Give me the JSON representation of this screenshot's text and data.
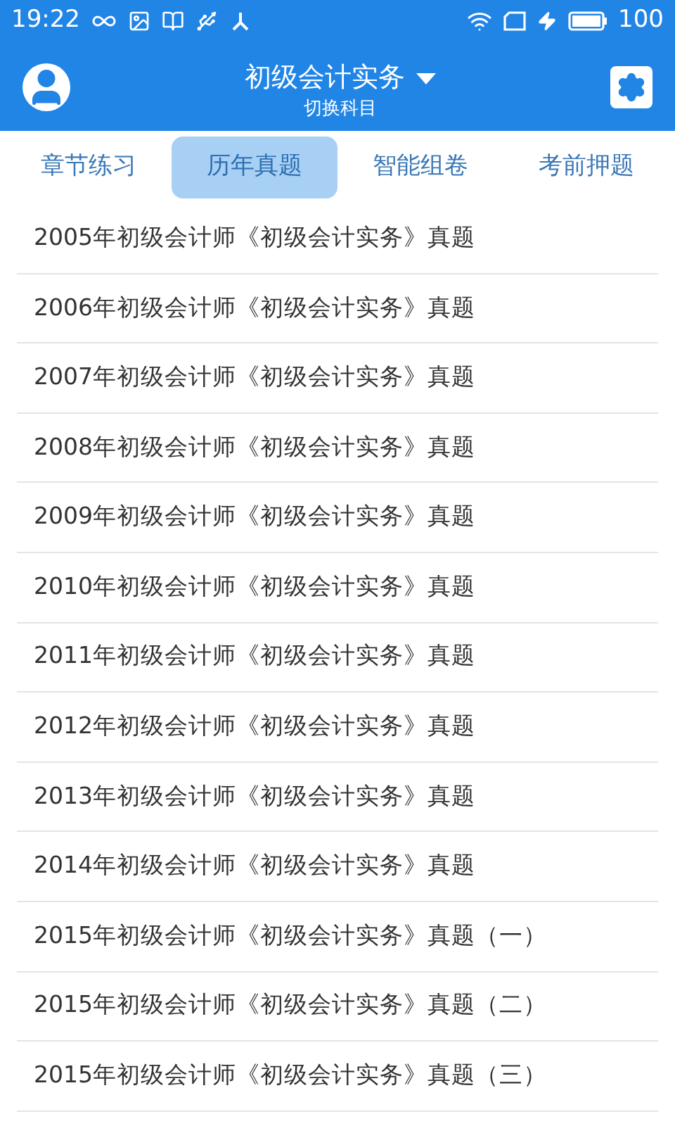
{
  "status_bar": {
    "time": "19:22",
    "battery": "100"
  },
  "header": {
    "title": "初级会计实务",
    "subtitle": "切换科目"
  },
  "tabs": [
    {
      "label": "章节练习",
      "selected": false
    },
    {
      "label": "历年真题",
      "selected": true
    },
    {
      "label": "智能组卷",
      "selected": false
    },
    {
      "label": "考前押题",
      "selected": false
    }
  ],
  "items": [
    "2005年初级会计师《初级会计实务》真题",
    "2006年初级会计师《初级会计实务》真题",
    "2007年初级会计师《初级会计实务》真题",
    "2008年初级会计师《初级会计实务》真题",
    "2009年初级会计师《初级会计实务》真题",
    "2010年初级会计师《初级会计实务》真题",
    "2011年初级会计师《初级会计实务》真题",
    "2012年初级会计师《初级会计实务》真题",
    "2013年初级会计师《初级会计实务》真题",
    "2014年初级会计师《初级会计实务》真题",
    "2015年初级会计师《初级会计实务》真题（一）",
    "2015年初级会计师《初级会计实务》真题（二）",
    "2015年初级会计师《初级会计实务》真题（三）"
  ]
}
